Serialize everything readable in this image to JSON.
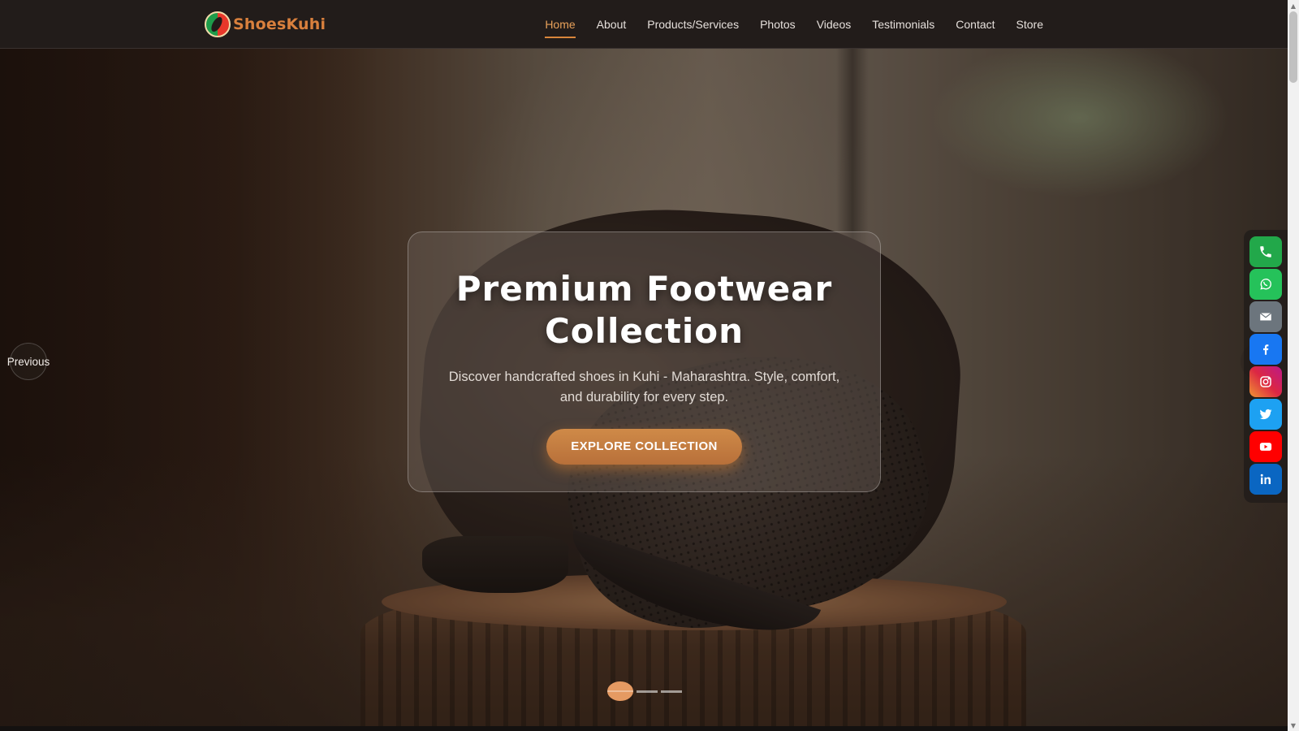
{
  "brand": {
    "name": "ShoesKuhi"
  },
  "nav": {
    "items": [
      {
        "label": "Home",
        "active": true
      },
      {
        "label": "About"
      },
      {
        "label": "Products/Services"
      },
      {
        "label": "Photos"
      },
      {
        "label": "Videos"
      },
      {
        "label": "Testimonials"
      },
      {
        "label": "Contact"
      },
      {
        "label": "Store"
      }
    ]
  },
  "hero": {
    "title": "Premium Footwear Collection",
    "subtitle": "Discover handcrafted shoes in Kuhi - Maharashtra. Style, comfort, and durability for every step.",
    "cta_label": "EXPLORE COLLECTION"
  },
  "carousel": {
    "prev_label": "Previous",
    "slide_count": 3,
    "active_slide": 1
  },
  "social": [
    {
      "name": "phone-icon",
      "color": "#22a84a"
    },
    {
      "name": "whatsapp-icon",
      "color": "#25c25a"
    },
    {
      "name": "email-icon",
      "color": "#6c757d"
    },
    {
      "name": "facebook-icon",
      "color": "#1877f2"
    },
    {
      "name": "instagram-icon",
      "color": "#d6336c"
    },
    {
      "name": "twitter-icon",
      "color": "#1da1f2"
    },
    {
      "name": "youtube-icon",
      "color": "#ff0000"
    },
    {
      "name": "linkedin-icon",
      "color": "#0a66c2"
    }
  ],
  "colors": {
    "accent": "#d9853b",
    "nav_bg": "#221c1a",
    "cta_bg": "#c47d41"
  }
}
